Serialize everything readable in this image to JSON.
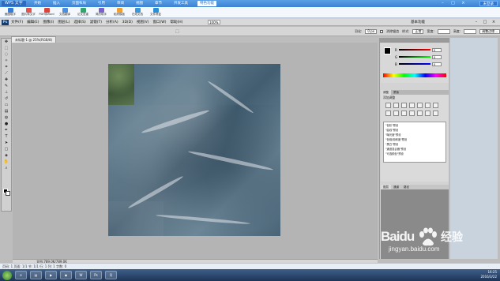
{
  "wps": {
    "app_name": "WPS 文字",
    "tabs": [
      "开始",
      "插入",
      "页面布局",
      "引用",
      "审阅",
      "视图",
      "章节",
      "开发工具",
      "特色功能"
    ],
    "login": "未登录",
    "ribbon": [
      "截图取字",
      "图片转文字",
      "PDF转Word",
      "文档翻译",
      "论文查重",
      "简历助手",
      "稻壳模板",
      "在线文档",
      "文件修复"
    ]
  },
  "photoshop": {
    "logo": "Ps",
    "menus": [
      "文件(F)",
      "编辑(E)",
      "图像(I)",
      "图层(L)",
      "选择(S)",
      "滤镜(T)",
      "分析(A)",
      "3D(D)",
      "视图(V)",
      "窗口(W)",
      "帮助(H)"
    ],
    "zoom": "100%",
    "workspace": "基本功能",
    "options": {
      "feather_label": "羽化:",
      "feather_value": "0 px",
      "antialias": "消除锯齿",
      "style_label": "样式:",
      "style_value": "正常",
      "width_label": "宽度:",
      "height_label": "高度:",
      "refine": "调整边缘..."
    },
    "doc_tab": "未标题-1 @ 25%(RGB/8)",
    "doc_status": "文档:789.0K/789.0K",
    "color_panel": {
      "sliders": [
        {
          "letter": "R",
          "value": "0"
        },
        {
          "letter": "G",
          "value": "0"
        },
        {
          "letter": "B",
          "value": "0"
        }
      ]
    },
    "adjust_panel": {
      "tabs": [
        "调整",
        "蒙版"
      ],
      "title": "添加调整",
      "presets": [
        "\"色阶\"预设",
        "\"曲线\"预设",
        "\"曝光度\"预设",
        "\"色相/饱和度\"预设",
        "\"黑白\"预设",
        "\"通道混合器\"预设",
        "\"可选颜色\"预设"
      ]
    },
    "layers_tabs": [
      "图层",
      "通道",
      "路径"
    ]
  },
  "wps_status": "页码: 1   页面: 1/1   节: 1/1   行: 1   列: 1   字数: 0",
  "clock": {
    "time": "16:25",
    "date": "2016/3/22"
  },
  "watermark": {
    "brand": "Baidu",
    "jingyan": "经验",
    "url": "jingyan.baidu.com"
  }
}
